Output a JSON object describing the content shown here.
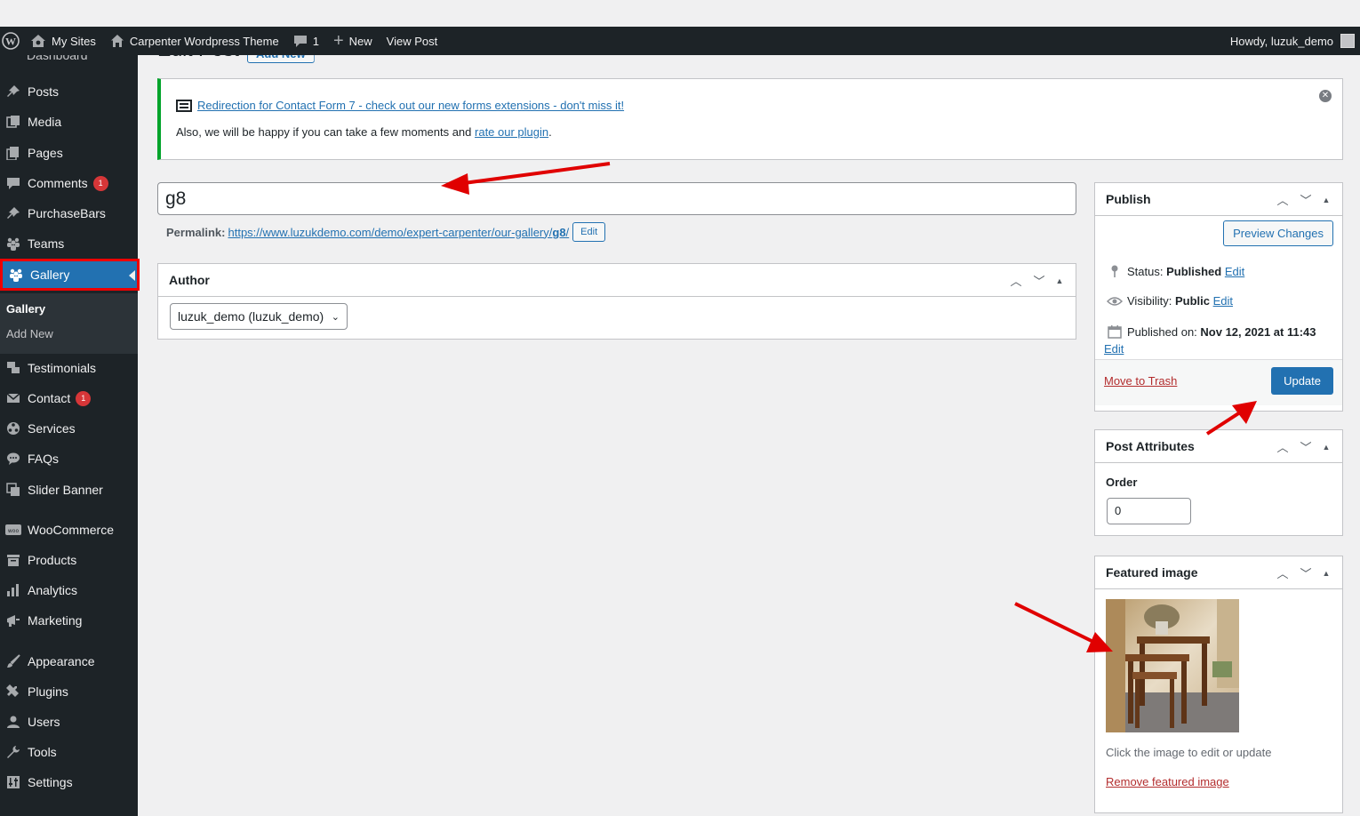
{
  "adminbar": {
    "my_sites": "My Sites",
    "site_name": "Carpenter Wordpress Theme",
    "comments_count": "1",
    "new_label": "New",
    "view_post": "View Post",
    "howdy": "Howdy, luzuk_demo"
  },
  "sidebar": {
    "partial_top": "Dashboard",
    "items": [
      {
        "label": "Posts",
        "icon": "pin-icon"
      },
      {
        "label": "Media",
        "icon": "media-icon"
      },
      {
        "label": "Pages",
        "icon": "pages-icon"
      },
      {
        "label": "Comments",
        "icon": "comments-icon",
        "badge": "1"
      },
      {
        "label": "PurchaseBars",
        "icon": "pin-icon"
      },
      {
        "label": "Teams",
        "icon": "groups-icon"
      },
      {
        "label": "Gallery",
        "icon": "groups-icon"
      },
      {
        "label": "Testimonials",
        "icon": "testimonial-icon"
      },
      {
        "label": "Contact",
        "icon": "email-icon",
        "badge": "1"
      },
      {
        "label": "Services",
        "icon": "services-icon"
      },
      {
        "label": "FAQs",
        "icon": "faq-icon"
      },
      {
        "label": "Slider Banner",
        "icon": "slider-icon"
      },
      {
        "label": "WooCommerce",
        "icon": "woo-icon"
      },
      {
        "label": "Products",
        "icon": "products-icon"
      },
      {
        "label": "Analytics",
        "icon": "analytics-icon"
      },
      {
        "label": "Marketing",
        "icon": "megaphone-icon"
      },
      {
        "label": "Appearance",
        "icon": "brush-icon"
      },
      {
        "label": "Plugins",
        "icon": "plugin-icon"
      },
      {
        "label": "Users",
        "icon": "users-icon"
      },
      {
        "label": "Tools",
        "icon": "wrench-icon"
      },
      {
        "label": "Settings",
        "icon": "settings-icon"
      }
    ],
    "submenu": [
      "Gallery",
      "Add New"
    ]
  },
  "page": {
    "title": "Edit Post",
    "add_new": "Add New"
  },
  "notice": {
    "link_text": "Redirection for Contact Form 7 - check out our new forms extensions - don't miss it!",
    "line2_prefix": "Also, we will be happy if you can take a few moments and ",
    "line2_link": "rate our plugin",
    "line2_suffix": "."
  },
  "post": {
    "title_value": "g8",
    "permalink_label": "Permalink:",
    "permalink_base": "https://www.luzukdemo.com/demo/expert-carpenter/our-gallery/",
    "permalink_slug": "g8",
    "permalink_slash": "/",
    "permalink_edit": "Edit"
  },
  "author_box": {
    "title": "Author",
    "selected": "luzuk_demo (luzuk_demo)"
  },
  "publish_box": {
    "title": "Publish",
    "preview": "Preview Changes",
    "status_label": "Status:",
    "status_value": "Published",
    "visibility_label": "Visibility:",
    "visibility_value": "Public",
    "published_label": "Published on:",
    "published_value": "Nov 12, 2021 at 11:43",
    "edit": "Edit",
    "trash": "Move to Trash",
    "update": "Update"
  },
  "attributes_box": {
    "title": "Post Attributes",
    "order_label": "Order",
    "order_value": "0"
  },
  "featured_box": {
    "title": "Featured image",
    "hint": "Click the image to edit or update",
    "remove": "Remove featured image"
  },
  "colors": {
    "adminbar_bg": "#1d2327",
    "accent": "#2271b1",
    "annotation_red": "#e00000",
    "notice_green": "#00a32a"
  }
}
